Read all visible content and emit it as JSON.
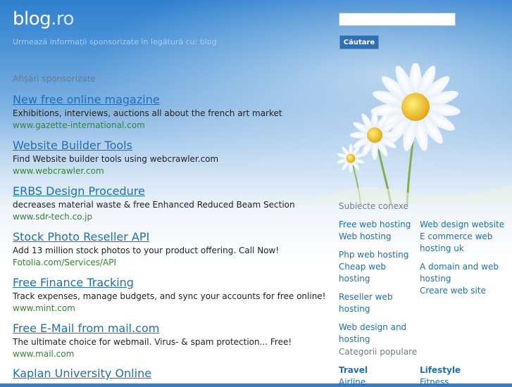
{
  "header": {
    "logo_main": "blog",
    "logo_tld": ".ro",
    "tagline": "Urmează informații sponsorizate în legătură cu: blog"
  },
  "search": {
    "placeholder": "",
    "button_label": "Căutare"
  },
  "ads": {
    "heading": "Afișări sponsorizate",
    "items": [
      {
        "title": "New free online magazine",
        "desc": "Exhibitions, interviews, auctions all about the french art market",
        "url": "www.gazette-international.com"
      },
      {
        "title": "Website Builder Tools",
        "desc": "Find Website builder tools using webcrawler.com",
        "url": "www.webcrawler.com"
      },
      {
        "title": "ERBS Design Procedure",
        "desc": "decreases material waste & free Enhanced Reduced Beam Section",
        "url": "www.sdr-tech.co.jp"
      },
      {
        "title": "Stock Photo Reseller API",
        "desc": "Add 13 million stock photos to your product offering. Call Now!",
        "url": "Fotolia.com/Services/API"
      },
      {
        "title": "Free Finance Tracking",
        "desc": "Track expenses, manage budgets, and sync your accounts for free online!",
        "url": "www.mint.com"
      },
      {
        "title": "Free E-Mail from mail.com",
        "desc": "The ultimate choice for webmail. Virus- & spam protection... Free!",
        "url": "www.mail.com"
      },
      {
        "title": "Kaplan University Online",
        "desc": "",
        "url": ""
      }
    ]
  },
  "related": {
    "heading": "Subiecte conexe",
    "left": [
      "Free web hosting",
      "Web hosting",
      "Php web hosting",
      "Cheap web hosting",
      "Reseller web hosting",
      "Web design and hosting"
    ],
    "right": [
      "Web design website",
      "E commerce web hosting uk",
      "A domain and web hosting",
      "Creare web site"
    ]
  },
  "popular": {
    "heading": "Categorii populare",
    "categories": [
      {
        "name": "Travel",
        "sub": "Airline"
      },
      {
        "name": "Lifestyle",
        "sub": "Fitness"
      }
    ]
  },
  "colors": {
    "link": "#1d6fb8",
    "url_green": "#2b8a2b",
    "button": "#2c6fb3"
  }
}
